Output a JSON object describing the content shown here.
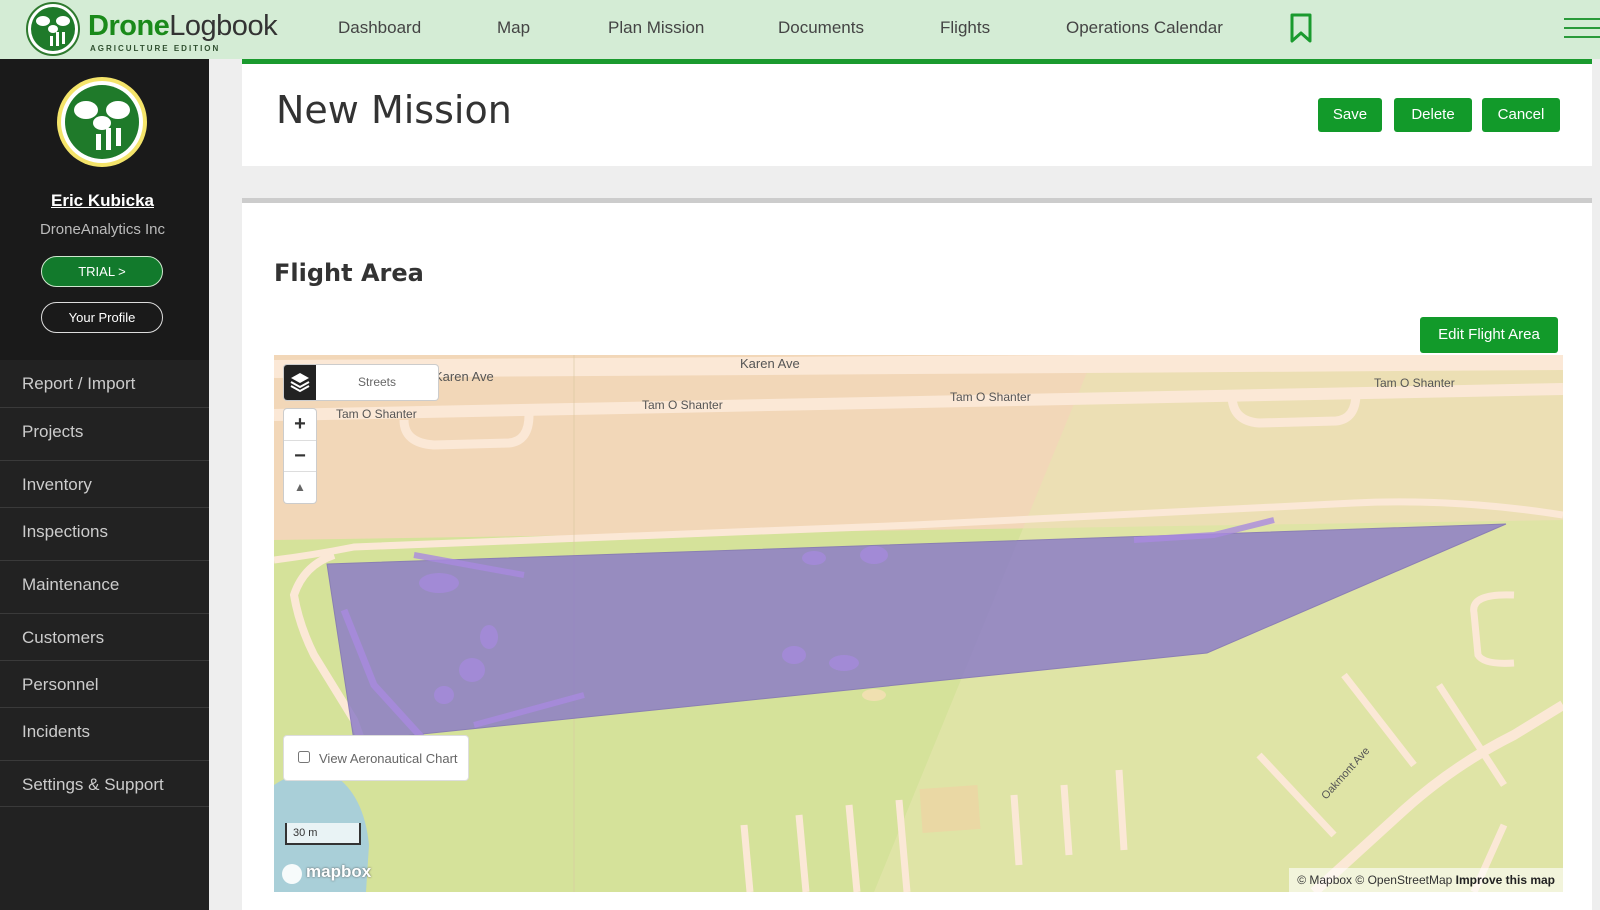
{
  "app": {
    "brand_bold": "Drone",
    "brand_light": "Logbook",
    "brand_sub": "AGRICULTURE EDITION"
  },
  "nav": {
    "items": [
      "Dashboard",
      "Map",
      "Plan Mission",
      "Documents",
      "Flights",
      "Operations Calendar"
    ]
  },
  "user": {
    "name": "Eric Kubicka",
    "company": "DroneAnalytics Inc",
    "trial_label": "TRIAL >",
    "profile_label": "Your Profile"
  },
  "sidebar": {
    "items": [
      "Report / Import",
      "Projects",
      "Inventory",
      "Inspections",
      "Maintenance",
      "Customers",
      "Personnel",
      "Incidents",
      "Settings & Support"
    ]
  },
  "page": {
    "title": "New Mission",
    "save": "Save",
    "delete": "Delete",
    "cancel": "Cancel"
  },
  "flight_area": {
    "title": "Flight Area",
    "edit_button": "Edit Flight Area"
  },
  "map": {
    "style_label": "Streets",
    "zoom_in": "+",
    "zoom_out": "−",
    "compass": "▲",
    "aero_label": "View Aeronautical Chart",
    "scale_label": "30 m",
    "mapbox": "mapbox",
    "attrib_mapbox": "© Mapbox",
    "attrib_osm": "© OpenStreetMap",
    "attrib_improve": "Improve this map",
    "streets": {
      "karen_ave_left": "Karen Ave",
      "karen_ave_mid": "Karen Ave",
      "tam_1": "Tam O Shanter",
      "tam_2": "Tam O Shanter",
      "tam_3": "Tam O Shanter",
      "tam_4": "Tam O Shanter",
      "oakmont": "Oakmont Ave"
    }
  },
  "colors": {
    "brand_green": "#129a2a",
    "nav_bg": "#d4ecd5",
    "sidebar_bg": "#222222",
    "polygon": "#8a7ac8"
  }
}
